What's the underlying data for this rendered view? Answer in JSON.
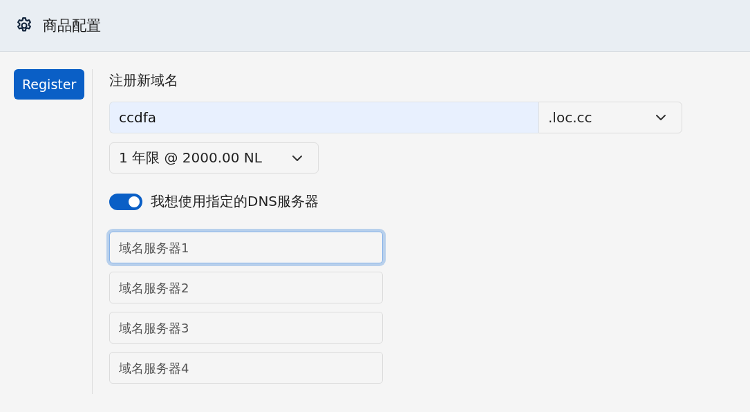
{
  "header": {
    "title": "商品配置"
  },
  "sidebar": {
    "button": "Register"
  },
  "form": {
    "heading": "注册新域名",
    "domain": {
      "value": "ccdfa"
    },
    "tld": {
      "value": ".loc.cc"
    },
    "period": {
      "value": "1 年限 @ 2000.00 NL"
    },
    "dns_toggle": {
      "label": "我想使用指定的DNS服务器",
      "on": true
    },
    "nameservers": [
      {
        "placeholder": "域名服务器1",
        "focused": true
      },
      {
        "placeholder": "域名服务器2",
        "focused": false
      },
      {
        "placeholder": "域名服务器3",
        "focused": false
      },
      {
        "placeholder": "域名服务器4",
        "focused": false
      }
    ]
  }
}
